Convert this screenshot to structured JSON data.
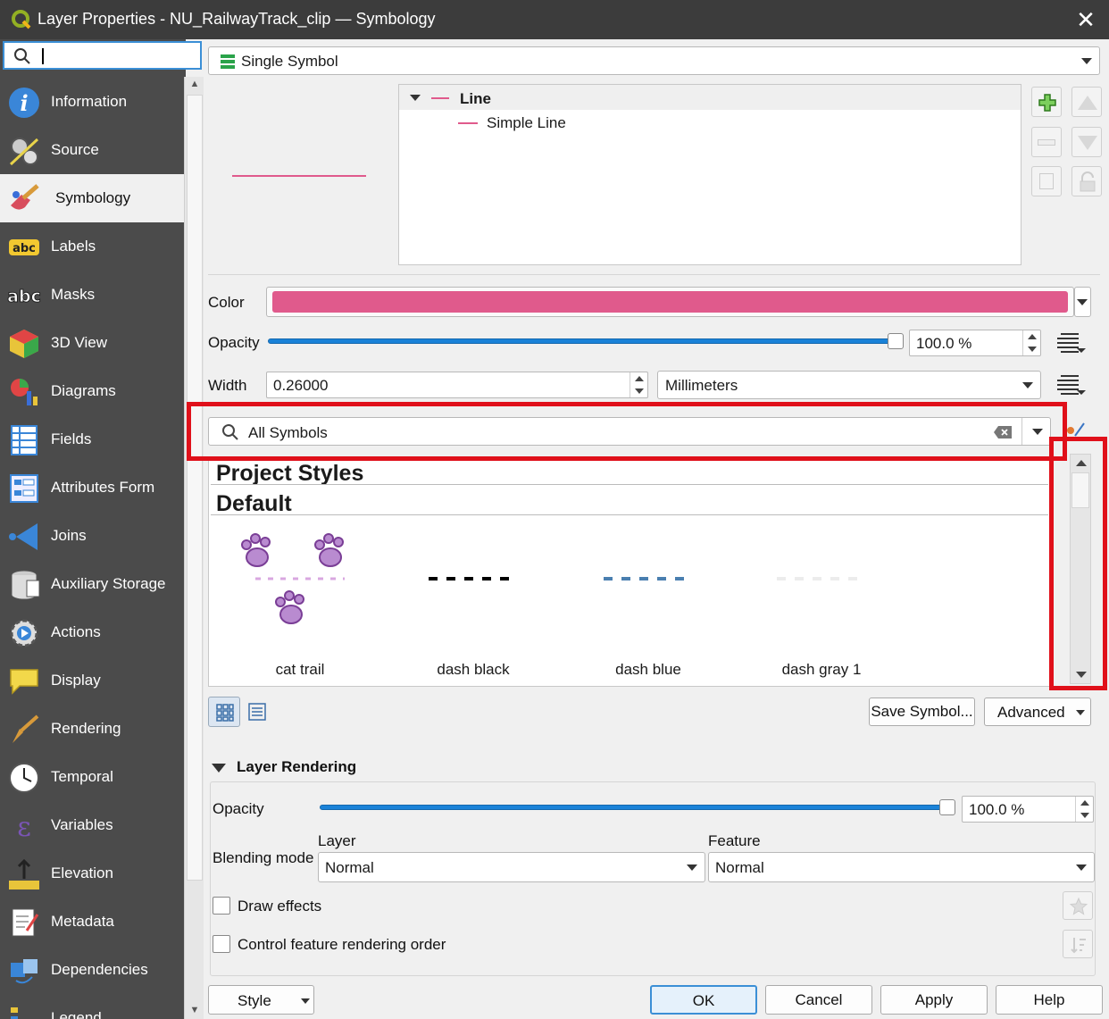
{
  "window": {
    "title": "Layer Properties - NU_RailwayTrack_clip — Symbology",
    "close_glyph": "✕"
  },
  "sidebar": {
    "search_placeholder": "",
    "items": [
      {
        "label": "Information",
        "icon": "information-icon"
      },
      {
        "label": "Source",
        "icon": "source-icon"
      },
      {
        "label": "Symbology",
        "icon": "symbology-icon"
      },
      {
        "label": "Labels",
        "icon": "labels-icon"
      },
      {
        "label": "Masks",
        "icon": "masks-icon"
      },
      {
        "label": "3D View",
        "icon": "3d-view-icon"
      },
      {
        "label": "Diagrams",
        "icon": "diagrams-icon"
      },
      {
        "label": "Fields",
        "icon": "fields-icon"
      },
      {
        "label": "Attributes Form",
        "icon": "attributes-form-icon"
      },
      {
        "label": "Joins",
        "icon": "joins-icon"
      },
      {
        "label": "Auxiliary Storage",
        "icon": "auxiliary-storage-icon"
      },
      {
        "label": "Actions",
        "icon": "actions-icon"
      },
      {
        "label": "Display",
        "icon": "display-icon"
      },
      {
        "label": "Rendering",
        "icon": "rendering-icon"
      },
      {
        "label": "Temporal",
        "icon": "temporal-icon"
      },
      {
        "label": "Variables",
        "icon": "variables-icon"
      },
      {
        "label": "Elevation",
        "icon": "elevation-icon"
      },
      {
        "label": "Metadata",
        "icon": "metadata-icon"
      },
      {
        "label": "Dependencies",
        "icon": "dependencies-icon"
      },
      {
        "label": "Legend",
        "icon": "legend-icon"
      }
    ],
    "active_index": 2
  },
  "renderer": {
    "selected": "Single Symbol"
  },
  "symbol_tree": {
    "root": "Line",
    "child": "Simple Line"
  },
  "symbol": {
    "color_label": "Color",
    "color_hex": "#e05a8c",
    "opacity_label": "Opacity",
    "opacity_value": "100.0 %",
    "opacity_fraction": 1.0,
    "width_label": "Width",
    "width_value": "0.26000",
    "unit": "Millimeters"
  },
  "library": {
    "filter": "All Symbols",
    "groups": [
      "Project Styles",
      "Default"
    ],
    "symbols": [
      {
        "name": "cat trail",
        "color": "#9b59b6"
      },
      {
        "name": "dash  black",
        "color": "#000000"
      },
      {
        "name": "dash blue",
        "color": "#4a7fb0"
      },
      {
        "name": "dash gray 1",
        "color": "#e8e8e8"
      }
    ],
    "save_button": "Save Symbol...",
    "advanced_button": "Advanced"
  },
  "layer_rendering": {
    "header": "Layer Rendering",
    "opacity_label": "Opacity",
    "opacity_value": "100.0 %",
    "opacity_fraction": 1.0,
    "blending_label": "Blending mode",
    "layer_label": "Layer",
    "layer_value": "Normal",
    "feature_label": "Feature",
    "feature_value": "Normal",
    "draw_effects": "Draw effects",
    "control_order": "Control feature rendering order"
  },
  "footer": {
    "style": "Style",
    "ok": "OK",
    "cancel": "Cancel",
    "apply": "Apply",
    "help": "Help"
  },
  "colors": {
    "accent": "#1a82d8",
    "highlight_box": "#e0101a",
    "sidebar_bg": "#4b4b4b"
  }
}
